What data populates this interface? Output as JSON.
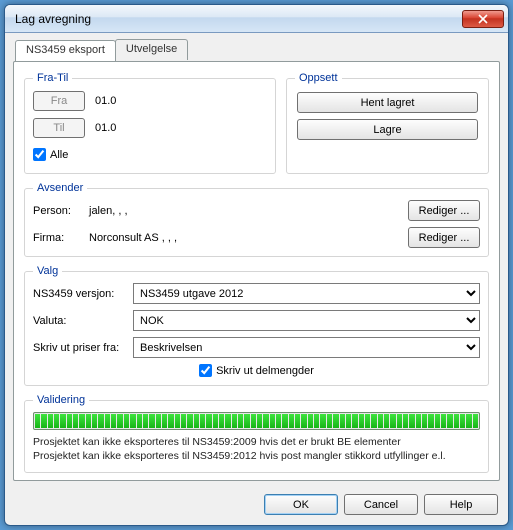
{
  "window": {
    "title": "Lag avregning"
  },
  "tabs": [
    {
      "label": "NS3459 eksport",
      "active": true
    },
    {
      "label": "Utvelgelse",
      "active": false
    }
  ],
  "fra_til": {
    "legend": "Fra-Til",
    "fra_btn": "Fra",
    "til_btn": "Til",
    "fra_val": "01.0",
    "til_val": "01.0",
    "alle_label": "Alle",
    "alle_checked": true
  },
  "oppsett": {
    "legend": "Oppsett",
    "hent": "Hent lagret",
    "lagre": "Lagre"
  },
  "avsender": {
    "legend": "Avsender",
    "person_lbl": "Person:",
    "person_val": "jalen, , ,",
    "firma_lbl": "Firma:",
    "firma_val": "Norconsult AS , , ,",
    "rediger": "Rediger ..."
  },
  "valg": {
    "legend": "Valg",
    "versjon_lbl": "NS3459 versjon:",
    "versjon_val": "NS3459 utgave 2012",
    "valuta_lbl": "Valuta:",
    "valuta_val": "NOK",
    "priser_lbl": "Skriv ut priser fra:",
    "priser_val": "Beskrivelsen",
    "delmengder_label": "Skriv ut delmengder",
    "delmengder_checked": true
  },
  "validering": {
    "legend": "Validering",
    "progress_pct": 100,
    "msg1": "Prosjektet kan ikke eksporteres til NS3459:2009 hvis det er brukt BE elementer",
    "msg2": "Prosjektet kan ikke eksporteres til NS3459:2012 hvis post mangler stikkord utfyllinger e.l."
  },
  "buttons": {
    "ok": "OK",
    "cancel": "Cancel",
    "help": "Help"
  }
}
